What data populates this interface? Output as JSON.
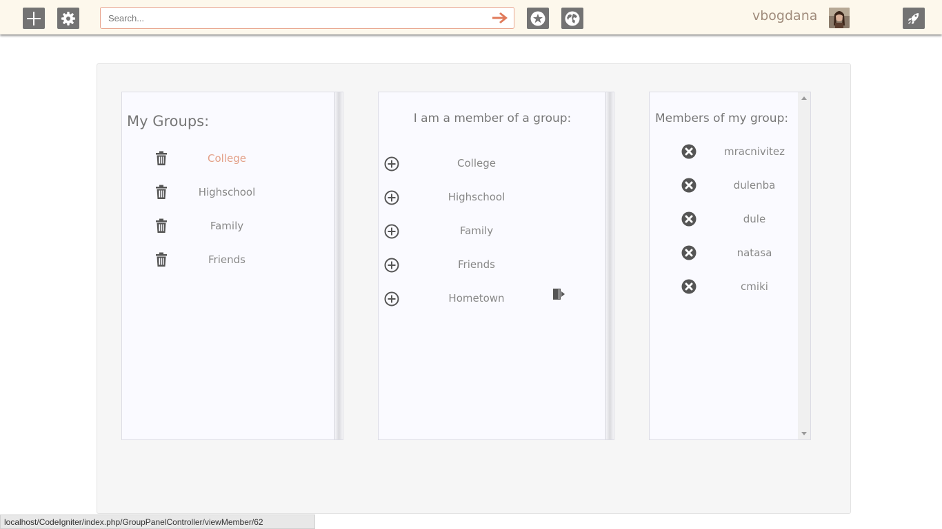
{
  "topbar": {
    "search_placeholder": "Search...",
    "username": "vbogdana",
    "icons": [
      "plus-icon",
      "gear-icon",
      "arrow-right-icon",
      "star-icon",
      "globe-icon",
      "avatar",
      "rocket-icon"
    ]
  },
  "my_groups": {
    "title": "My Groups:",
    "items": [
      {
        "label": "College",
        "active": true
      },
      {
        "label": "Highschool"
      },
      {
        "label": "Family"
      },
      {
        "label": "Friends"
      }
    ]
  },
  "member_of": {
    "title": "I am a member of a group:",
    "items": [
      {
        "label": "College"
      },
      {
        "label": "Highschool"
      },
      {
        "label": "Family"
      },
      {
        "label": "Friends"
      },
      {
        "label": "Hometown",
        "leave_icon": true
      }
    ]
  },
  "members": {
    "title": "Members of my group:",
    "items": [
      {
        "label": "mracnivitez"
      },
      {
        "label": "dulenba"
      },
      {
        "label": "dule"
      },
      {
        "label": "natasa"
      },
      {
        "label": "cmiki"
      }
    ]
  },
  "status_url": "localhost/CodeIgniter/index.php/GroupPanelController/viewMember/62",
  "colors": {
    "accent": "#e3a088",
    "topbar_bg": "#fdf8ec",
    "icon_bg": "#737373"
  }
}
